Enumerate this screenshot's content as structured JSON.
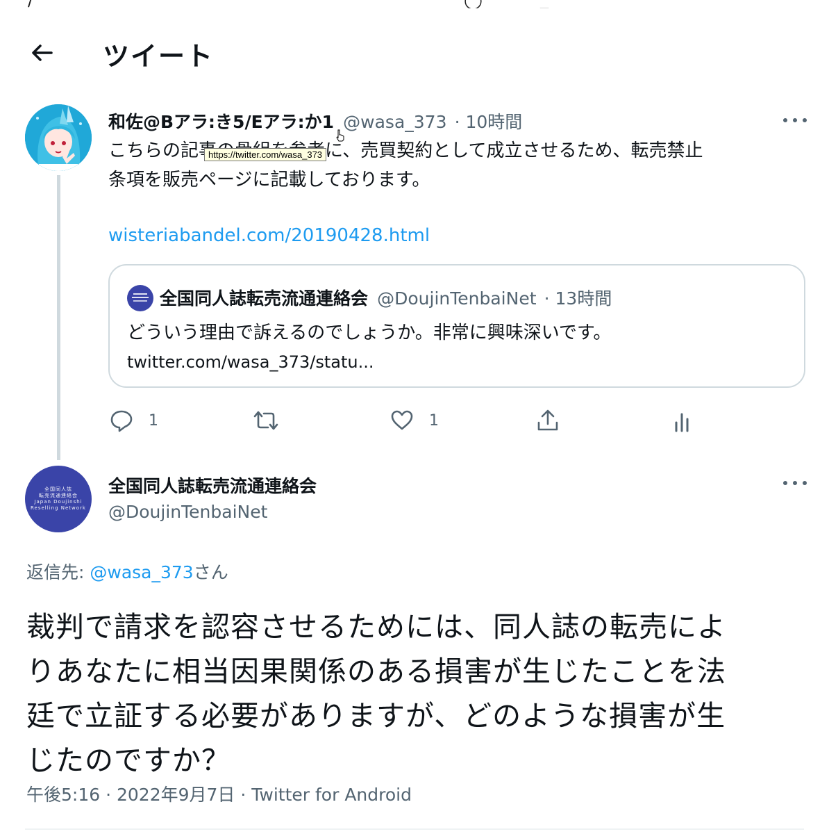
{
  "header": {
    "title": "ツイート"
  },
  "parent_tweet": {
    "display_name": "和佐@Bアラ:き5/Eアラ:か1",
    "handle": "@wasa_373",
    "time": "· 10時間",
    "text_line1": "こちらの記事の骨組を参考に、売買契約として成立させるため、転売禁止",
    "text_line2": "条項を販売ページに記載しております。",
    "link": "wisteriabandel.com/20190428.html",
    "tooltip": "https://twitter.com/wasa_373",
    "quote": {
      "display_name": "全国同人誌転売流通連絡会",
      "handle": "@DoujinTenbaiNet",
      "time": "· 13時間",
      "text": "どういう理由で訴えるのでしょうか。非常に興味深いです。",
      "link": "twitter.com/wasa_373/statu..."
    },
    "actions": {
      "reply_count": "1",
      "retweet_count": "",
      "like_count": "1"
    }
  },
  "main_tweet": {
    "display_name": "全国同人誌転売流通連絡会",
    "handle": "@DoujinTenbaiNet",
    "avatar_text": [
      "全国同人誌",
      "転売流通連絡会",
      "Japan Doujinshi",
      "Reselling Network"
    ],
    "reply_label": "返信先: ",
    "reply_to": "@wasa_373",
    "reply_suffix": "さん",
    "text_lines": [
      "裁判で請求を認容させるためには、同人誌の転売によ",
      "りあなたに相当因果関係のある損害が生じたことを法",
      "廷で立証する必要がありますが、どのような損害が生",
      "じたのですか？"
    ],
    "timestamp": "午後5:16 · 2022年9月7日 · Twitter for Android"
  },
  "colors": {
    "text": "#0f1419",
    "secondary": "#536471",
    "link": "#1d9bf0",
    "border": "#cfd9de",
    "org_avatar": "#3a44a8"
  }
}
